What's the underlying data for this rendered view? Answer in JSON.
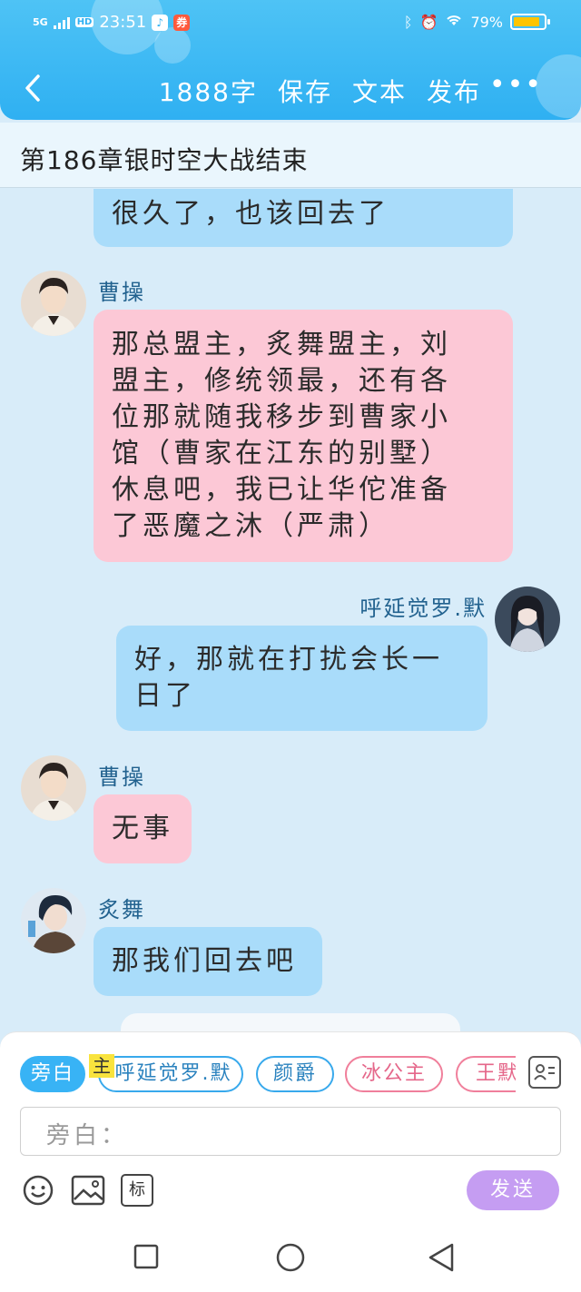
{
  "status_bar": {
    "network": "5G",
    "hd": "HD",
    "time": "23:51",
    "battery_percent": "79%",
    "battery_level": 0.79
  },
  "header": {
    "back_icon": "back-arrow-icon",
    "word_count": "1888字",
    "save": "保存",
    "text": "文本",
    "publish": "发布",
    "more": "•••"
  },
  "chapter": {
    "title": "第186章银时空大战结束"
  },
  "messages": [
    {
      "side": "left",
      "speaker": "",
      "text": "很久了，也该回去了",
      "color": "blue"
    },
    {
      "side": "left",
      "speaker": "曹操",
      "lines": [
        "那总盟主，炙舞盟主，刘",
        "盟主，修统领最，还有各",
        "位那就随我移步到曹家小",
        "馆（曹家在江东的别墅）",
        "休息吧，我已让华佗准备",
        "了恶魔之沐（严肃）"
      ],
      "color": "pink"
    },
    {
      "side": "right",
      "speaker": "呼延觉罗.默",
      "lines": [
        "好，那就在打扰会长一",
        "日了"
      ],
      "color": "blue"
    },
    {
      "side": "left",
      "speaker": "曹操",
      "text": "无事",
      "color": "pink"
    },
    {
      "side": "left",
      "speaker": "炙舞",
      "text": "那我们回去吧",
      "color": "blue"
    }
  ],
  "input_panel": {
    "roles": [
      {
        "label": "旁白",
        "style": "active"
      },
      {
        "label": "呼延觉罗.默",
        "style": "blue"
      },
      {
        "label": "颜爵",
        "style": "blue"
      },
      {
        "label": "冰公主",
        "style": "pink"
      },
      {
        "label": "王默",
        "style": "pink"
      }
    ],
    "main_tag": "主",
    "input_placeholder": "旁白：",
    "send": "发送",
    "tag_button": "标",
    "colors": {
      "accent": "#38b3f5",
      "send": "#c59df2",
      "pink_bubble": "#fcc8d6",
      "blue_bubble": "#a9dcfa"
    }
  }
}
